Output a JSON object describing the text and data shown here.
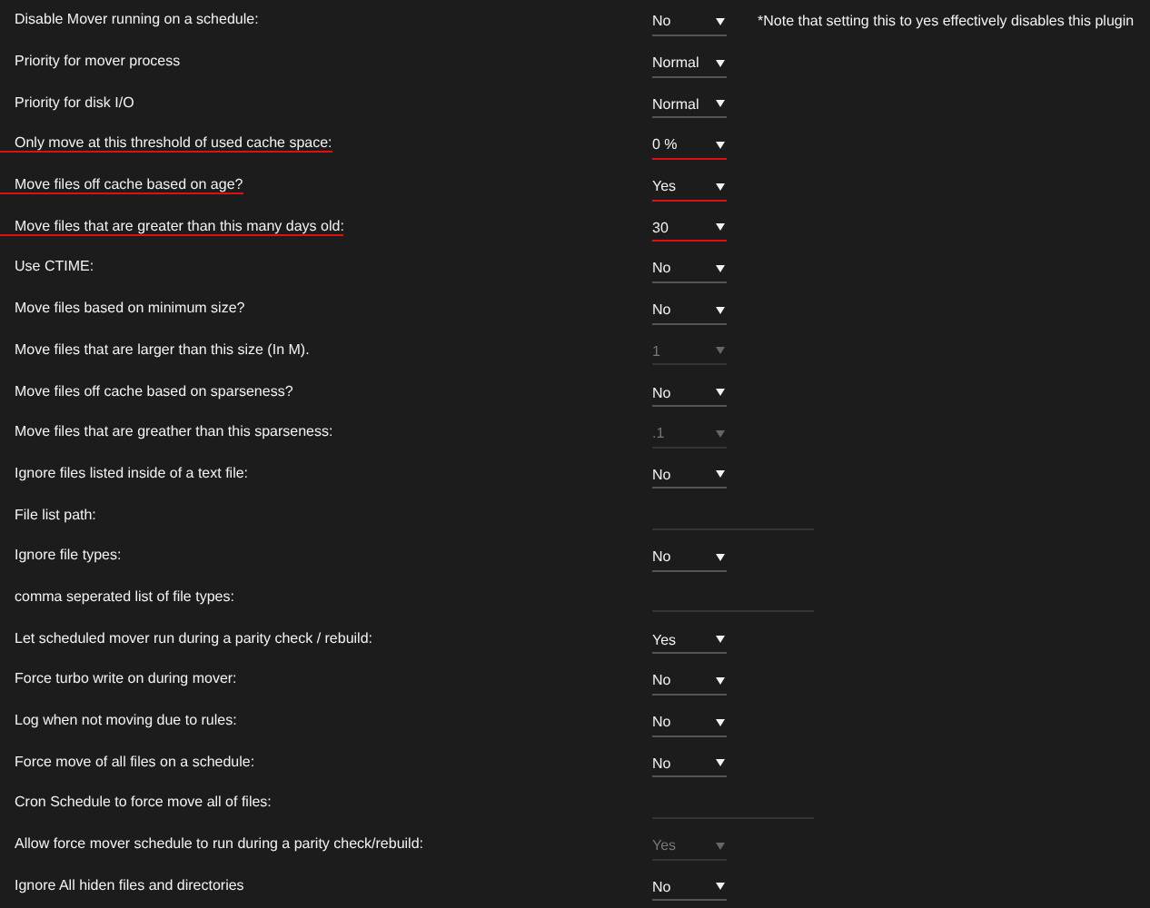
{
  "settings": [
    {
      "label": "Disable Mover running on a schedule:",
      "kind": "select",
      "value": "No",
      "disabled": false,
      "underlined": false,
      "note": "*Note that setting this to yes effectively disables this plugin"
    },
    {
      "label": "Priority for mover process",
      "kind": "select",
      "value": "Normal",
      "disabled": false,
      "underlined": false
    },
    {
      "label": "Priority for disk I/O",
      "kind": "select",
      "value": "Normal",
      "disabled": false,
      "underlined": false
    },
    {
      "label": "Only move at this threshold of used cache space:",
      "kind": "select",
      "value": "0 %",
      "disabled": false,
      "underlined": true
    },
    {
      "label": "Move files off cache based on age?",
      "kind": "select",
      "value": "Yes",
      "disabled": false,
      "underlined": true
    },
    {
      "label": "Move files that are greater than this many days old:",
      "kind": "select",
      "value": "30",
      "disabled": false,
      "underlined": true
    },
    {
      "label": "Use CTIME:",
      "kind": "select",
      "value": "No",
      "disabled": false,
      "underlined": false
    },
    {
      "label": "Move files based on minimum size?",
      "kind": "select",
      "value": "No",
      "disabled": false,
      "underlined": false
    },
    {
      "label": "Move files that are larger than this size (In M).",
      "kind": "select",
      "value": "1",
      "disabled": true,
      "underlined": false
    },
    {
      "label": "Move files off cache based on sparseness?",
      "kind": "select",
      "value": "No",
      "disabled": false,
      "underlined": false
    },
    {
      "label": "Move files that are greather than this sparseness:",
      "kind": "select",
      "value": ".1",
      "disabled": true,
      "underlined": false
    },
    {
      "label": "Ignore files listed inside of a text file:",
      "kind": "select",
      "value": "No",
      "disabled": false,
      "underlined": false
    },
    {
      "label": "File list path:",
      "kind": "text",
      "underlined": false
    },
    {
      "label": "Ignore file types:",
      "kind": "select",
      "value": "No",
      "disabled": false,
      "underlined": false
    },
    {
      "label": "comma seperated list of file types:",
      "kind": "text",
      "underlined": false
    },
    {
      "label": "Let scheduled mover run during a parity check / rebuild:",
      "kind": "select",
      "value": "Yes",
      "disabled": false,
      "underlined": false
    },
    {
      "label": "Force turbo write on during mover:",
      "kind": "select",
      "value": "No",
      "disabled": false,
      "underlined": false
    },
    {
      "label": "Log when not moving due to rules:",
      "kind": "select",
      "value": "No",
      "disabled": false,
      "underlined": false
    },
    {
      "label": "Force move of all files on a schedule:",
      "kind": "select",
      "value": "No",
      "disabled": false,
      "underlined": false
    },
    {
      "label": "Cron Schedule to force move all of files:",
      "kind": "text",
      "underlined": false
    },
    {
      "label": "Allow force mover schedule to run during a parity check/rebuild:",
      "kind": "select",
      "value": "Yes",
      "disabled": true,
      "underlined": false
    },
    {
      "label": "Ignore All hiden files and directories",
      "kind": "select",
      "value": "No",
      "disabled": false,
      "underlined": false
    }
  ]
}
